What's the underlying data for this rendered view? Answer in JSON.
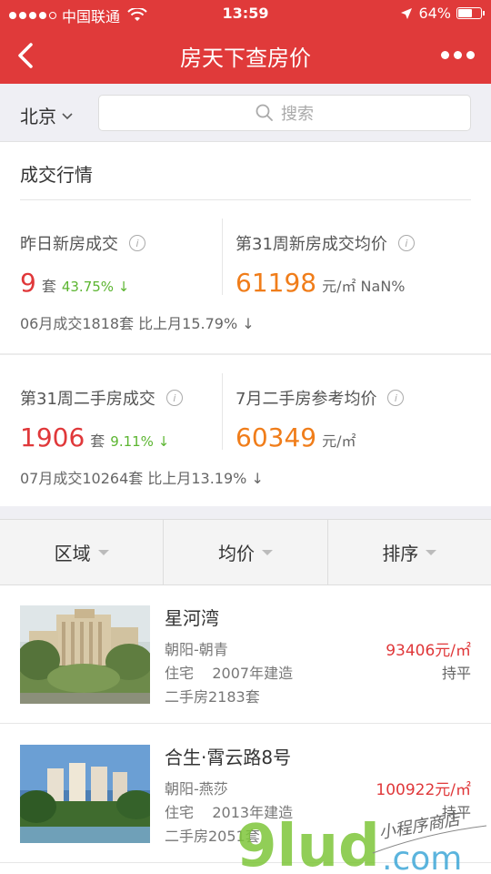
{
  "status_bar": {
    "carrier": "中国联通",
    "time": "13:59",
    "battery": "64%",
    "battery_level": 0.64
  },
  "nav": {
    "title": "房天下查房价"
  },
  "search": {
    "city": "北京",
    "placeholder": "搜索"
  },
  "market": {
    "title": "成交行情",
    "block1": {
      "left_label": "昨日新房成交",
      "left_value": "9",
      "left_unit": "套",
      "left_pct": "43.75% ↓",
      "right_label": "第31周新房成交均价",
      "right_value": "61198",
      "right_unit": "元/㎡ NaN%",
      "footer": "06月成交1818套  比上月15.79% ↓"
    },
    "block2": {
      "left_label": "第31周二手房成交",
      "left_value": "1906",
      "left_unit": "套",
      "left_pct": "9.11% ↓",
      "right_label": "7月二手房参考均价",
      "right_value": "60349",
      "right_unit": "元/㎡",
      "footer": "07月成交10264套  比上月13.19% ↓"
    }
  },
  "filters": [
    "区域",
    "均价",
    "排序"
  ],
  "listings": [
    {
      "name": "星河湾",
      "district": "朝阳-朝青",
      "type_year": "住宅    2007年建造",
      "resale": "二手房2183套",
      "price": "93406元/㎡",
      "trend": "持平"
    },
    {
      "name": "合生·霄云路8号",
      "district": "朝阳-燕莎",
      "type_year": "住宅    2013年建造",
      "resale": "二手房2051套",
      "price": "100922元/㎡",
      "trend": "持平"
    }
  ],
  "watermark": {
    "brand": "9lud",
    "domain": ".com",
    "tagline": "小程序商店"
  }
}
